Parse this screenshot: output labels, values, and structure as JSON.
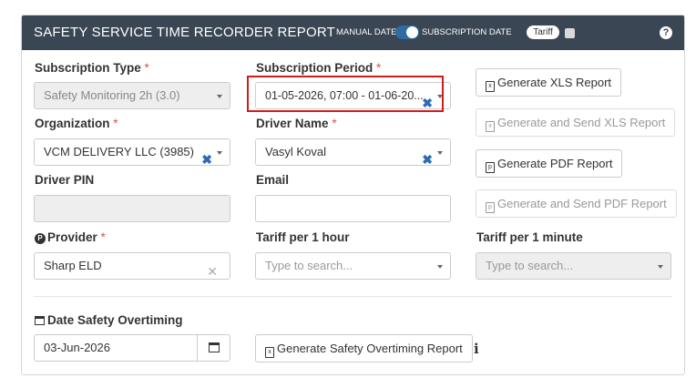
{
  "header": {
    "title": "SAFETY SERVICE TIME RECORDER REPORT",
    "manual_date_label": "MANUAL DATE",
    "subscription_date_label": "SUBSCRIPTION DATE",
    "tariff_label": "Tariff",
    "help": "?"
  },
  "form": {
    "subscription_type": {
      "label": "Subscription Type",
      "required": "*",
      "value": "Safety Monitoring 2h (3.0)"
    },
    "subscription_period": {
      "label": "Subscription Period",
      "required": "*",
      "value": "01-05-2026, 07:00 - 01-06-20..."
    },
    "organization": {
      "label": "Organization",
      "required": "*",
      "value": "VCM DELIVERY LLC (3985)"
    },
    "driver_name": {
      "label": "Driver Name",
      "required": "*",
      "value": "Vasyl Koval"
    },
    "driver_pin": {
      "label": "Driver PIN",
      "value": ""
    },
    "email": {
      "label": "Email",
      "value": ""
    },
    "provider": {
      "label": "Provider",
      "required": "*",
      "value": "Sharp ELD"
    },
    "tariff_hour": {
      "label": "Tariff per 1 hour",
      "placeholder": "Type to search..."
    },
    "tariff_minute": {
      "label": "Tariff per 1 minute",
      "placeholder": "Type to search..."
    },
    "date_safety_overtiming": {
      "label": "Date Safety Overtiming",
      "value": "03-Jun-2026"
    }
  },
  "buttons": {
    "generate_xls": "Generate XLS Report",
    "generate_send_xls": "Generate and Send XLS Report",
    "generate_pdf": "Generate PDF Report",
    "generate_send_pdf": "Generate and Send PDF Report",
    "generate_overtiming": "Generate Safety Overtiming Report"
  },
  "icons": {
    "clear": "✖",
    "clear_grey": "✕",
    "xls_glyph": "x",
    "pdf_glyph": "p",
    "provider_glyph": "P",
    "info": "i"
  },
  "colors": {
    "header_bg": "#3a4654",
    "required": "#d9534f",
    "clear_icon": "#2a6cb3",
    "highlight": "#d01c1c"
  }
}
